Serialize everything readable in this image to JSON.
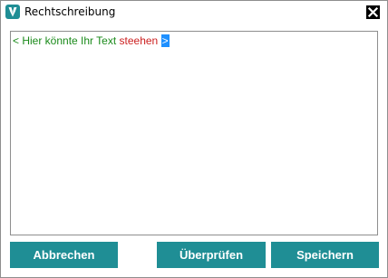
{
  "window": {
    "title": "Rechtschreibung",
    "accent_color": "#1f8e95",
    "icons": {
      "app": "app-logo-icon",
      "close": "close-icon"
    }
  },
  "editor": {
    "text_prefix": "< Hier könnte Ihr Text ",
    "misspelled_word": "steehen",
    "text_suffix": ">"
  },
  "buttons": {
    "cancel_label": "Abbrechen",
    "check_label": "Überprüfen",
    "save_label": "Speichern"
  }
}
